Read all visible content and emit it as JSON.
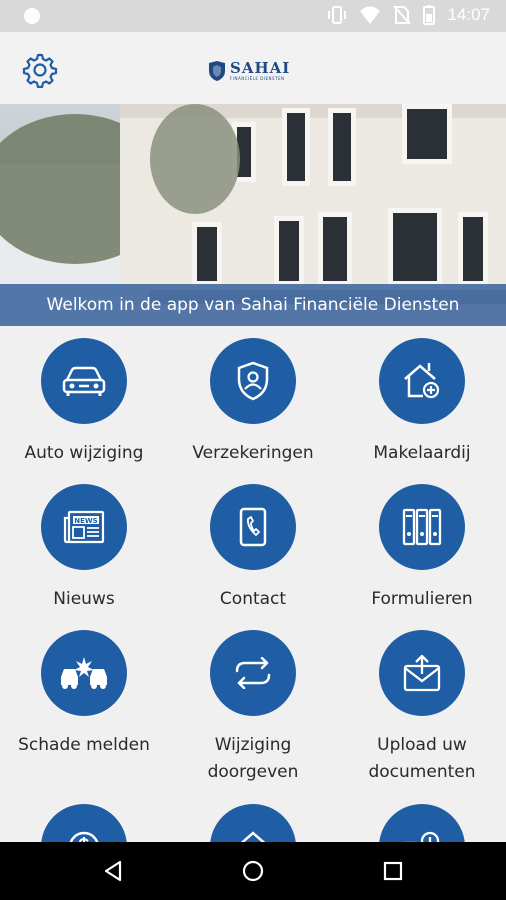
{
  "status_bar": {
    "time": "14:07",
    "icons": [
      "vibrate-icon",
      "wifi-icon",
      "no-sim-icon",
      "battery-icon"
    ]
  },
  "app_bar": {
    "settings_icon": "gear-icon",
    "logo_text": "SAHAI",
    "logo_subtext": "FINANCIËLE DIENSTEN"
  },
  "hero": {
    "banner_text": "Welkom in de app van Sahai Financiële Diensten"
  },
  "menu": {
    "items": [
      {
        "label": "Auto wijziging",
        "icon": "car-icon"
      },
      {
        "label": "Verzekeringen",
        "icon": "shield-person-icon"
      },
      {
        "label": "Makelaardij",
        "icon": "house-plus-icon"
      },
      {
        "label": "Nieuws",
        "icon": "newspaper-icon"
      },
      {
        "label": "Contact",
        "icon": "phone-icon"
      },
      {
        "label": "Formulieren",
        "icon": "binders-icon"
      },
      {
        "label": "Schade melden",
        "icon": "car-crash-icon"
      },
      {
        "label": "Wijziging doorgeven",
        "icon": "refresh-arrows-icon"
      },
      {
        "label": "Upload uw documenten",
        "icon": "envelope-upload-icon"
      },
      {
        "label": "",
        "icon": "money-icon"
      },
      {
        "label": "",
        "icon": "house-icon"
      },
      {
        "label": "",
        "icon": "info-icon"
      }
    ]
  },
  "colors": {
    "accent": "#1f5ea4",
    "banner": "#3e659e",
    "logo": "#1e4a86"
  }
}
